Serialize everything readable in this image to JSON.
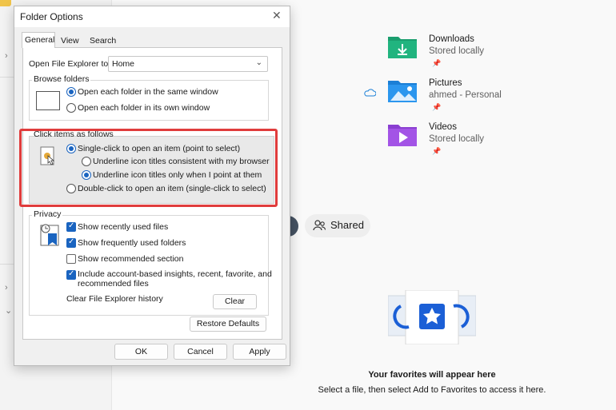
{
  "dialog": {
    "title": "Folder Options",
    "tabs": [
      "General",
      "View",
      "Search"
    ],
    "open_explorer_label": "Open File Explorer to:",
    "open_explorer_value": "Home",
    "browse_folders": {
      "title": "Browse folders",
      "option1": "Open each folder in the same window",
      "option2": "Open each folder in its own window"
    },
    "click_items": {
      "title": "Click items as follows",
      "option1": "Single-click to open an item (point to select)",
      "sub1": "Underline icon titles consistent with my browser",
      "sub2": "Underline icon titles only when I point at them",
      "option2": "Double-click to open an item (single-click to select)"
    },
    "privacy": {
      "title": "Privacy",
      "check1": "Show recently used files",
      "check2": "Show frequently used folders",
      "check3": "Show recommended section",
      "check4_line1": "Include account-based insights, recent, favorite, and",
      "check4_line2": "recommended files",
      "clear_label": "Clear File Explorer history",
      "clear_button": "Clear"
    },
    "restore_defaults": "Restore Defaults",
    "ok": "OK",
    "cancel": "Cancel",
    "apply": "Apply"
  },
  "quick_access": [
    {
      "name": "Downloads",
      "sub": "Stored locally",
      "color": "#1a9e6e"
    },
    {
      "name": "Pictures",
      "sub": "ahmed - Personal",
      "color": "#1b7fd6"
    },
    {
      "name": "Videos",
      "sub": "Stored locally",
      "color": "#8a3fd1"
    }
  ],
  "shared_label": "Shared",
  "favorites": {
    "title": "Your favorites will appear here",
    "subtitle": "Select a file, then select Add to Favorites to access it here."
  },
  "colors": {
    "accent": "#1a64c0",
    "highlight": "#e03c3c"
  }
}
